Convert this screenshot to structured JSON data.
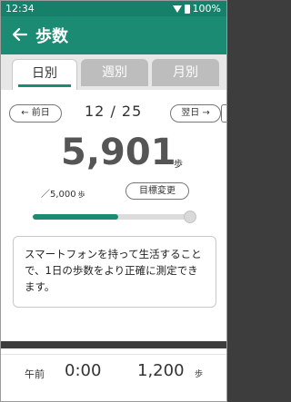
{
  "status_bar": {
    "time": "12:34",
    "battery": "100%"
  },
  "app_bar": {
    "title": "歩数"
  },
  "tabs": [
    {
      "label": "日別",
      "selected": true
    },
    {
      "label": "週別",
      "selected": false
    },
    {
      "label": "月別",
      "selected": false
    }
  ],
  "date_nav": {
    "prev_label": "← 前日",
    "date": "12 / 25",
    "next_label": "翌日 →"
  },
  "summary": {
    "steps": "5,901",
    "steps_unit": "歩",
    "goal_value": "／5,000",
    "goal_unit": "歩",
    "goal_button": "目標変更",
    "progress_fraction": 0.55
  },
  "info": {
    "message": "スマートフォンを持って生活することで、1日の歩数をより正確に測定できます。"
  },
  "hourly": [
    {
      "period": "午前",
      "time": "0:00",
      "steps": "1,200",
      "unit": "歩"
    }
  ],
  "colors": {
    "primary": "#1c8b73",
    "status_bar": "#17806a",
    "tab_inactive": "#bdbdbd"
  }
}
